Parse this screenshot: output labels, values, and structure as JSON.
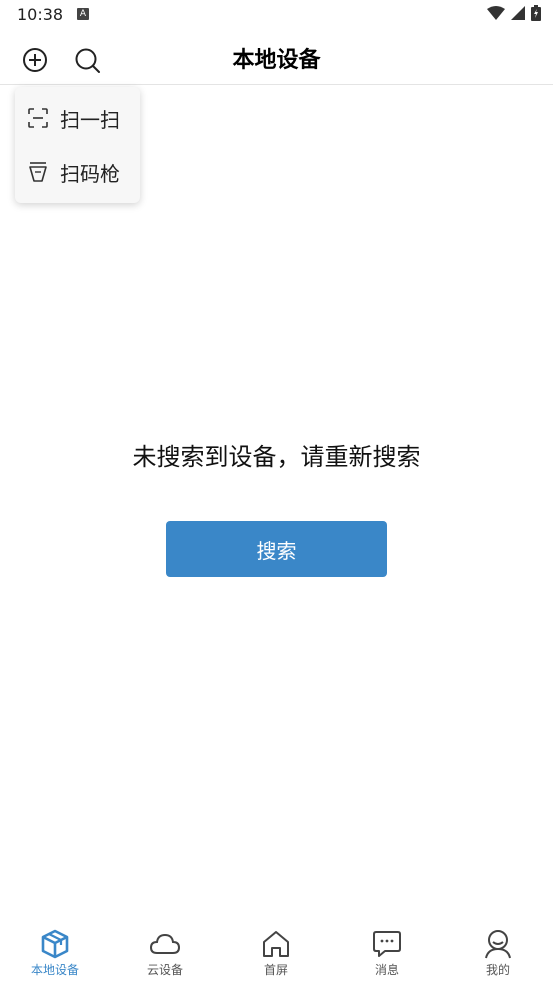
{
  "status_bar": {
    "time": "10:38",
    "notification_icon_letter": "A"
  },
  "header": {
    "title": "本地设备",
    "add_icon": "plus-circle-icon",
    "search_icon": "search-icon"
  },
  "popup_menu": {
    "items": [
      {
        "label": "扫一扫",
        "icon": "scan-icon"
      },
      {
        "label": "扫码枪",
        "icon": "scanner-gun-icon"
      }
    ]
  },
  "empty_state": {
    "message": "未搜索到设备，请重新搜索",
    "button_label": "搜索"
  },
  "tabbar": {
    "items": [
      {
        "label": "本地设备",
        "icon": "box-icon",
        "active": true
      },
      {
        "label": "云设备",
        "icon": "cloud-icon",
        "active": false
      },
      {
        "label": "首屏",
        "icon": "home-icon",
        "active": false
      },
      {
        "label": "消息",
        "icon": "message-icon",
        "active": false
      },
      {
        "label": "我的",
        "icon": "user-icon",
        "active": false
      }
    ]
  },
  "colors": {
    "accent": "#3a87c8",
    "inactive": "#555555",
    "popup_bg": "#f7f7f7"
  }
}
